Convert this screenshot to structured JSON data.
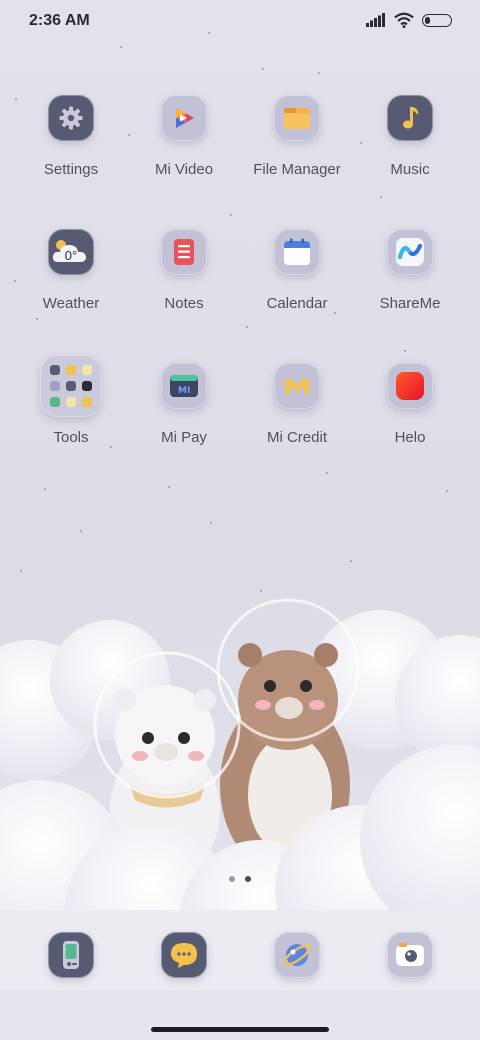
{
  "status_bar": {
    "time": "2:36 AM"
  },
  "apps": [
    {
      "label": "Settings"
    },
    {
      "label": "Mi Video"
    },
    {
      "label": "File Manager"
    },
    {
      "label": "Music"
    },
    {
      "label": "Weather",
      "icon_text": "0°"
    },
    {
      "label": "Notes"
    },
    {
      "label": "Calendar"
    },
    {
      "label": "ShareMe"
    },
    {
      "label": "Tools"
    },
    {
      "label": "Mi Pay"
    },
    {
      "label": "Mi Credit"
    },
    {
      "label": "Helo"
    }
  ],
  "page_indicator": {
    "pages": 2,
    "current": 2
  },
  "dock": [
    {
      "icon": "phone-icon"
    },
    {
      "icon": "messages-icon"
    },
    {
      "icon": "browser-icon"
    },
    {
      "icon": "camera-icon"
    }
  ],
  "colors": {
    "background": "#e3e2ec",
    "icon_tile_light": "#c2c1d5",
    "icon_tile_dark": "#575a73",
    "label_text": "#50505e"
  }
}
